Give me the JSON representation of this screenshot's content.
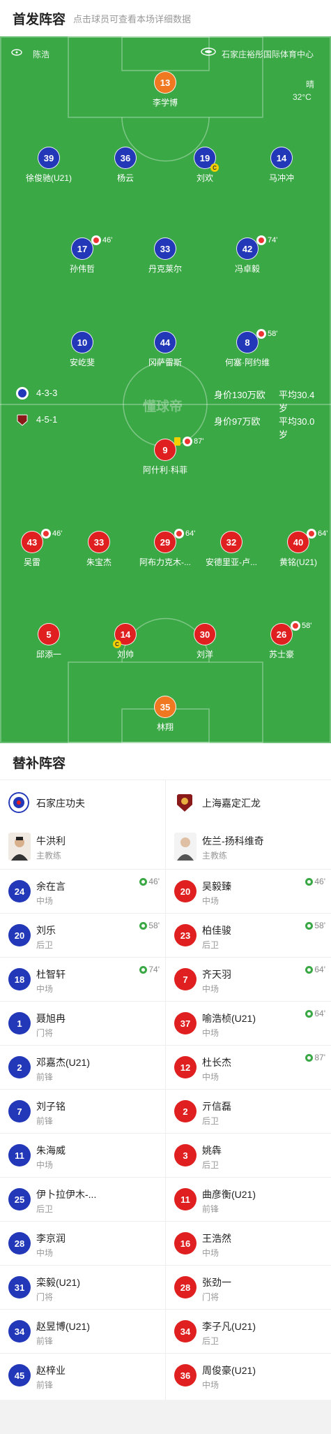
{
  "header": {
    "title": "首发阵容",
    "hint": "点击球员可查看本场详细数据"
  },
  "match": {
    "referee": "陈浩",
    "stadium": "石家庄裕彤国际体育中心",
    "weather": "晴",
    "temperature": "32°C",
    "watermark": "懂球帝"
  },
  "home_form": {
    "formation": "4-3-3",
    "value": "身价130万欧",
    "age": "平均30.4岁"
  },
  "away_form": {
    "formation": "4-5-1",
    "value": "身价97万欧",
    "age": "平均30.0岁"
  },
  "home_lineup": {
    "gk": {
      "number": "13",
      "name": "李学博"
    },
    "def": [
      {
        "number": "39",
        "name": "徐俊驰(U21)"
      },
      {
        "number": "36",
        "name": "杨云"
      },
      {
        "number": "19",
        "name": "刘欢",
        "captain": "C"
      },
      {
        "number": "14",
        "name": "马冲冲"
      }
    ],
    "mid": [
      {
        "number": "17",
        "name": "孙伟哲",
        "sub_minute": "46'"
      },
      {
        "number": "33",
        "name": "丹克莱尔"
      },
      {
        "number": "42",
        "name": "冯卓毅",
        "sub_minute": "74'"
      }
    ],
    "fwd": [
      {
        "number": "10",
        "name": "安屹斐"
      },
      {
        "number": "44",
        "name": "冈萨雷斯"
      },
      {
        "number": "8",
        "name": "何塞·阿约维",
        "sub_minute": "58'"
      }
    ]
  },
  "away_lineup": {
    "fwd": [
      {
        "number": "9",
        "name": "阿什利·科菲",
        "sub_minute": "87'"
      }
    ],
    "mid": [
      {
        "number": "43",
        "name": "吴雷",
        "sub_minute": "46'"
      },
      {
        "number": "33",
        "name": "朱宝杰"
      },
      {
        "number": "29",
        "name": "阿布力克木-...",
        "sub_minute": "64'"
      },
      {
        "number": "32",
        "name": "安德里亚-卢..."
      },
      {
        "number": "40",
        "name": "黄铭(U21)",
        "sub_minute": "64'"
      }
    ],
    "def": [
      {
        "number": "5",
        "name": "邱添一"
      },
      {
        "number": "14",
        "name": "刘帅",
        "captain": "C"
      },
      {
        "number": "30",
        "name": "刘洋"
      },
      {
        "number": "26",
        "name": "苏士豪",
        "sub_minute": "58'"
      }
    ],
    "gk": {
      "number": "35",
      "name": "林翔"
    }
  },
  "subs": {
    "title": "替补阵容",
    "home": {
      "team": "石家庄功夫",
      "coach": {
        "name": "牛洪利",
        "role": "主教练"
      },
      "players": [
        {
          "number": "24",
          "name": "余在言",
          "pos": "中场",
          "in": "46'"
        },
        {
          "number": "20",
          "name": "刘乐",
          "pos": "后卫",
          "in": "58'"
        },
        {
          "number": "18",
          "name": "杜智轩",
          "pos": "中场",
          "in": "74'"
        },
        {
          "number": "1",
          "name": "聂旭冉",
          "pos": "门将"
        },
        {
          "number": "2",
          "name": "邓嘉杰(U21)",
          "pos": "前锋"
        },
        {
          "number": "7",
          "name": "刘子铭",
          "pos": "前锋"
        },
        {
          "number": "11",
          "name": "朱海威",
          "pos": "中场"
        },
        {
          "number": "25",
          "name": "伊卜拉伊木-...",
          "pos": "后卫"
        },
        {
          "number": "28",
          "name": "李京润",
          "pos": "中场"
        },
        {
          "number": "31",
          "name": "栾毅(U21)",
          "pos": "门将"
        },
        {
          "number": "34",
          "name": "赵昱博(U21)",
          "pos": "前锋"
        },
        {
          "number": "45",
          "name": "赵梓业",
          "pos": "前锋"
        }
      ]
    },
    "away": {
      "team": "上海嘉定汇龙",
      "coach": {
        "name": "佐兰-扬科维奇",
        "role": "主教练"
      },
      "players": [
        {
          "number": "20",
          "name": "吴毅臻",
          "pos": "中场",
          "in": "46'"
        },
        {
          "number": "23",
          "name": "柏佳骏",
          "pos": "后卫",
          "in": "58'"
        },
        {
          "number": "7",
          "name": "齐天羽",
          "pos": "中场",
          "in": "64'"
        },
        {
          "number": "37",
          "name": "喻浩桢(U21)",
          "pos": "中场",
          "in": "64'"
        },
        {
          "number": "12",
          "name": "杜长杰",
          "pos": "中场",
          "in": "87'"
        },
        {
          "number": "2",
          "name": "亓信磊",
          "pos": "后卫"
        },
        {
          "number": "3",
          "name": "姚犇",
          "pos": "后卫"
        },
        {
          "number": "11",
          "name": "曲彦衡(U21)",
          "pos": "前锋"
        },
        {
          "number": "16",
          "name": "王浩然",
          "pos": "中场"
        },
        {
          "number": "28",
          "name": "张劲一",
          "pos": "门将"
        },
        {
          "number": "34",
          "name": "李子凡(U21)",
          "pos": "后卫"
        },
        {
          "number": "36",
          "name": "周俊豪(U21)",
          "pos": "中场"
        }
      ]
    }
  },
  "colors": {
    "pitch": "#3aa845",
    "home": "#2238b8",
    "away": "#e02020",
    "gk": "#f07820"
  }
}
